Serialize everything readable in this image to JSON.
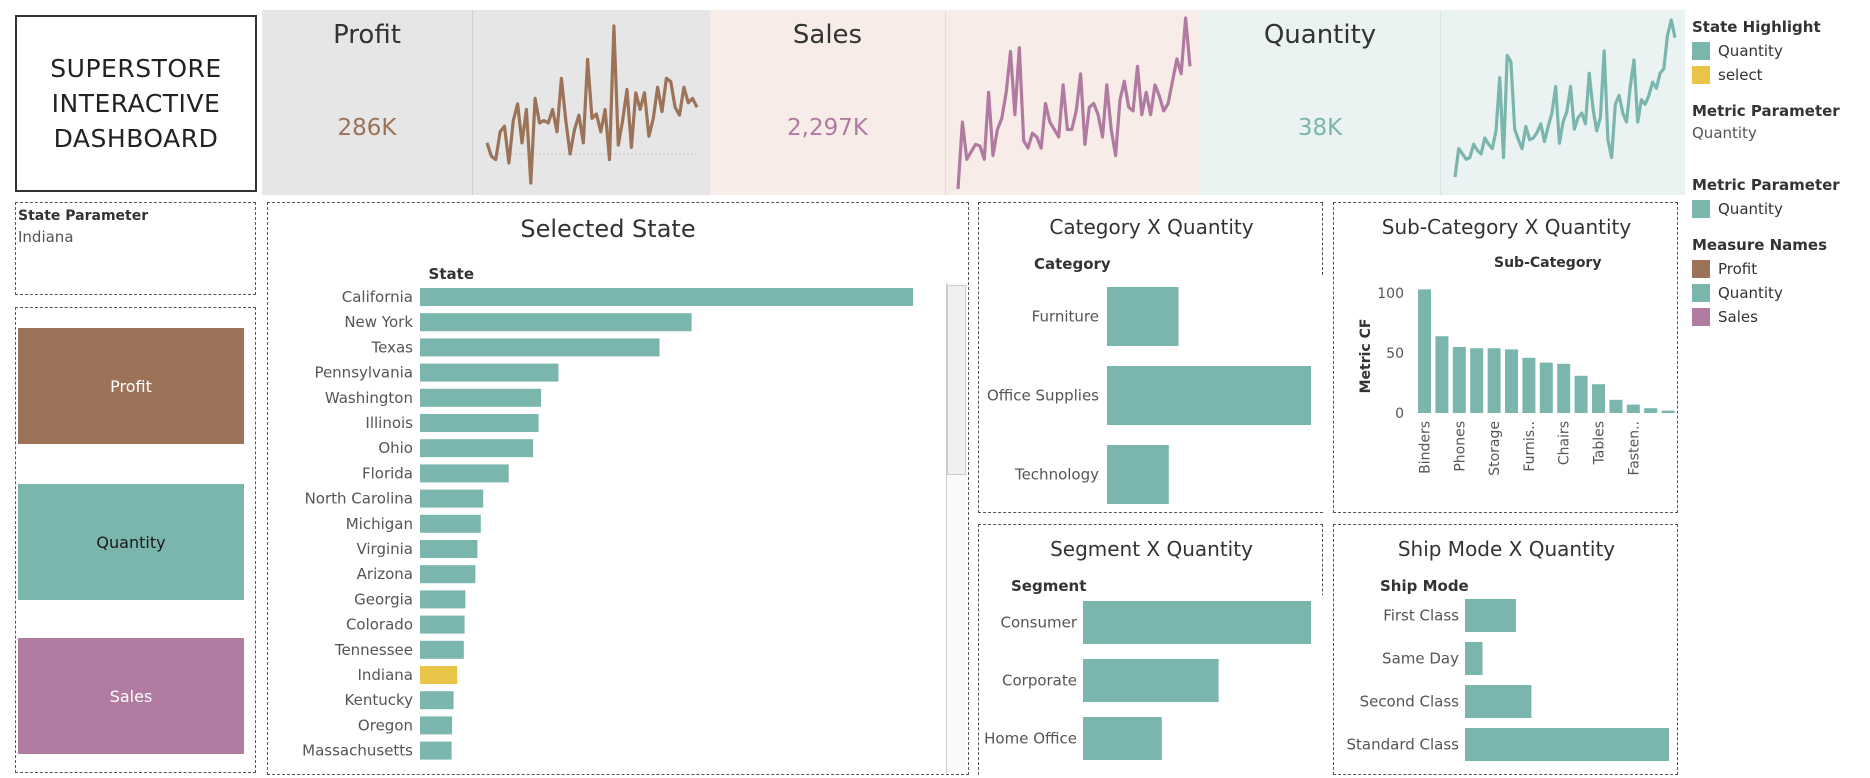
{
  "colors": {
    "profit": "#9c7358",
    "quantity": "#7ab5ae",
    "sales": "#b07aa1",
    "highlight": "#e8c547",
    "kpi_profit_bg": "#e6e6e6",
    "kpi_sales_bg": "#f8ece8",
    "kpi_qty_bg": "#eaf3f1"
  },
  "title": {
    "line1": "SUPERSTORE",
    "line2": "INTERACTIVE",
    "line3": "DASHBOARD"
  },
  "kpis": [
    {
      "name": "Profit",
      "value": "286K",
      "color": "#9c7358"
    },
    {
      "name": "Sales",
      "value": "2,297K",
      "color": "#b07aa1"
    },
    {
      "name": "Quantity",
      "value": "38K",
      "color": "#7ab5ae"
    }
  ],
  "state_param": {
    "label": "State Parameter",
    "value": "Indiana"
  },
  "metric_buttons": [
    {
      "label": "Profit",
      "color": "#9c7358",
      "text_color": "#ffffff"
    },
    {
      "label": "Quantity",
      "color": "#7ab5ae",
      "text_color": "#1a1a1a"
    },
    {
      "label": "Sales",
      "color": "#b07aa1",
      "text_color": "#ffffff"
    }
  ],
  "legend": {
    "state_highlight": {
      "title": "State Highlight",
      "items": [
        {
          "label": "Quantity",
          "color": "#7ab5ae"
        },
        {
          "label": "select",
          "color": "#e8c547"
        }
      ]
    },
    "metric_param_1": {
      "title": "Metric Parameter",
      "value": "Quantity"
    },
    "metric_param_2": {
      "title": "Metric Parameter",
      "items": [
        {
          "label": "Quantity",
          "color": "#7ab5ae"
        }
      ]
    },
    "measure_names": {
      "title": "Measure Names",
      "items": [
        {
          "label": "Profit",
          "color": "#9c7358"
        },
        {
          "label": "Quantity",
          "color": "#7ab5ae"
        },
        {
          "label": "Sales",
          "color": "#b07aa1"
        }
      ]
    }
  },
  "chart_data": [
    {
      "type": "line",
      "id": "profit_sparkline",
      "series": [
        {
          "name": "Profit",
          "values": [
            60,
            48,
            45,
            70,
            75,
            42,
            80,
            95,
            60,
            90,
            24,
            100,
            78,
            80,
            78,
            90,
            70,
            118,
            80,
            50,
            72,
            85,
            60,
            135,
            82,
            86,
            70,
            90,
            45,
            165,
            58,
            80,
            108,
            56,
            105,
            90,
            105,
            66,
            82,
            110,
            88,
            118,
            115,
            92,
            85,
            110,
            96,
            100,
            92
          ]
        }
      ]
    },
    {
      "type": "line",
      "id": "sales_sparkline",
      "series": [
        {
          "name": "Sales",
          "values": [
            20,
            110,
            60,
            70,
            80,
            78,
            60,
            150,
            65,
            100,
            115,
            150,
            205,
            120,
            210,
            85,
            75,
            95,
            90,
            75,
            135,
            110,
            100,
            90,
            160,
            100,
            100,
            125,
            175,
            80,
            130,
            135,
            120,
            90,
            160,
            100,
            65,
            140,
            165,
            130,
            125,
            185,
            120,
            150,
            120,
            160,
            145,
            125,
            135,
            165,
            195,
            175,
            250,
            185
          ]
        }
      ]
    },
    {
      "type": "line",
      "id": "quantity_sparkline",
      "series": [
        {
          "name": "Quantity",
          "values": [
            18,
            50,
            44,
            38,
            40,
            55,
            48,
            44,
            62,
            55,
            50,
            70,
            130,
            40,
            155,
            148,
            72,
            60,
            50,
            75,
            60,
            62,
            68,
            78,
            58,
            75,
            90,
            120,
            56,
            80,
            92,
            120,
            72,
            85,
            90,
            78,
            135,
            95,
            70,
            85,
            160,
            60,
            40,
            100,
            110,
            90,
            80,
            120,
            150,
            80,
            105,
            100,
            110,
            125,
            118,
            135,
            140,
            178,
            195,
            175
          ]
        }
      ]
    },
    {
      "type": "bar",
      "id": "selected_state",
      "title": "Selected State",
      "ylabel": "State",
      "categories": [
        "California",
        "New York",
        "Texas",
        "Pennsylvania",
        "Washington",
        "Illinois",
        "Ohio",
        "Florida",
        "North Carolina",
        "Michigan",
        "Virginia",
        "Arizona",
        "Georgia",
        "Colorado",
        "Tennessee",
        "Indiana",
        "Kentucky",
        "Oregon",
        "Massachusetts"
      ],
      "values": [
        7667,
        4224,
        3724,
        2153,
        1883,
        1845,
        1759,
        1379,
        983,
        946,
        893,
        862,
        705,
        693,
        681,
        578,
        523,
        499,
        491
      ],
      "highlight": "Indiana"
    },
    {
      "type": "bar",
      "id": "category_qty",
      "title": "Category  X Quantity",
      "ylabel": "Category",
      "categories": [
        "Furniture",
        "Office Supplies",
        "Technology"
      ],
      "values": [
        8028,
        22906,
        6939
      ]
    },
    {
      "type": "bar",
      "id": "subcategory_qty",
      "title": "Sub-Category X Quantity",
      "xlabel": "Sub-Category",
      "ylabel": "Metric CF",
      "ylim": [
        0,
        110
      ],
      "yticks": [
        0,
        50,
        100
      ],
      "categories": [
        "Binders",
        "",
        "Phones",
        "",
        "Storage",
        "",
        "Furnis..",
        "",
        "Chairs",
        "",
        "Tables",
        "",
        "Fasten..",
        ""
      ],
      "values": [
        103,
        64,
        55,
        54,
        54,
        53,
        46,
        42,
        41,
        31,
        24,
        11,
        7,
        4,
        2
      ]
    },
    {
      "type": "bar",
      "id": "segment_qty",
      "title": "Segment X Quantity",
      "ylabel": "Segment",
      "categories": [
        "Consumer",
        "Corporate",
        "Home Office"
      ],
      "values": [
        19521,
        11608,
        6744
      ]
    },
    {
      "type": "bar",
      "id": "shipmode_qty",
      "title": "Ship Mode X Quantity",
      "ylabel": "Ship Mode",
      "categories": [
        "First Class",
        "Same Day",
        "Second Class",
        "Standard Class"
      ],
      "values": [
        5693,
        1960,
        7418,
        22797
      ]
    }
  ]
}
